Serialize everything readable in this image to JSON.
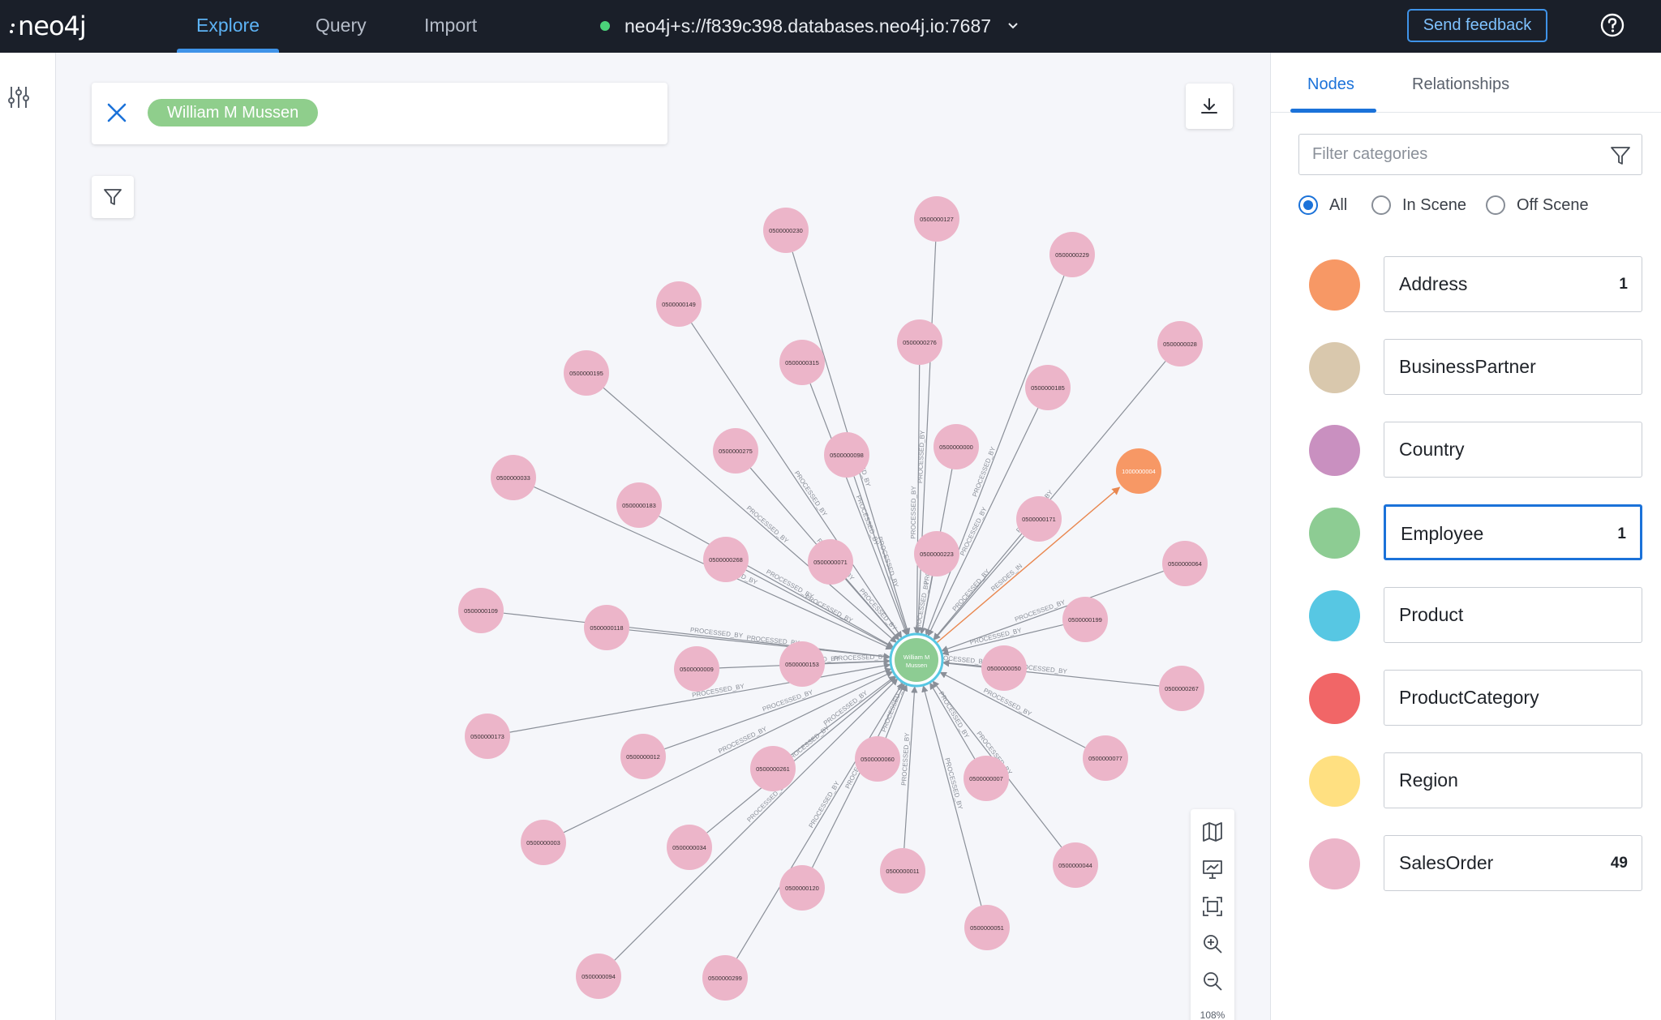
{
  "app": {
    "logo_text": "neo4j"
  },
  "nav": {
    "tabs": [
      {
        "label": "Explore",
        "active": true
      },
      {
        "label": "Query",
        "active": false
      },
      {
        "label": "Import",
        "active": false
      }
    ]
  },
  "connection": {
    "url": "neo4j+s://f839c398.databases.neo4j.io:7687",
    "status_color": "#4bd37a"
  },
  "header": {
    "feedback_label": "Send feedback",
    "help_icon": "help-circle-icon"
  },
  "search": {
    "pill_label": "William M Mussen",
    "pill_color": "#8fce8c"
  },
  "zoom": {
    "level_label": "108%"
  },
  "panel": {
    "tabs": [
      {
        "label": "Nodes",
        "active": true
      },
      {
        "label": "Relationships",
        "active": false
      }
    ],
    "filter_placeholder": "Filter categories",
    "scope_options": [
      {
        "label": "All",
        "selected": true
      },
      {
        "label": "In Scene",
        "selected": false
      },
      {
        "label": "Off Scene",
        "selected": false
      }
    ],
    "categories": [
      {
        "name": "Address",
        "count": "1",
        "color": "#f79865"
      },
      {
        "name": "BusinessPartner",
        "count": "",
        "color": "#d9c8ad"
      },
      {
        "name": "Country",
        "count": "",
        "color": "#c990c0"
      },
      {
        "name": "Employee",
        "count": "1",
        "color": "#8dcc93",
        "focused": true
      },
      {
        "name": "Product",
        "count": "",
        "color": "#57c7e3"
      },
      {
        "name": "ProductCategory",
        "count": "",
        "color": "#f16667"
      },
      {
        "name": "Region",
        "count": "",
        "color": "#ffe081"
      },
      {
        "name": "SalesOrder",
        "count": "49",
        "color": "#ecb5c9"
      }
    ]
  },
  "graph": {
    "center": {
      "label_line1": "William M",
      "label_line2": "Mussen",
      "color": "#8dcc93",
      "ring": "#57c7e3"
    },
    "relationship_label": "PROCESSED_BY",
    "address_label": "1000000004",
    "address_rel_label": "RESIDES_IN",
    "order_color": "#ecb5c9",
    "address_color": "#f79865",
    "orders": [
      "0500000230",
      "0500000127",
      "0500000229",
      "0500000149",
      "0500000276",
      "0500000028",
      "0500000195",
      "0500000315",
      "0500000185",
      "0500000000",
      "0500000033",
      "0500000275",
      "0500000098",
      "0500000183",
      "0500000171",
      "0500000064",
      "0500000268",
      "0500000071",
      "0500000223",
      "0500000109",
      "0500000118",
      "0500000199",
      "0500000009",
      "0500000153",
      "0500000050",
      "0500000267",
      "0500000173",
      "0500000012",
      "0500000261",
      "0500000060",
      "0500000007",
      "0500000077",
      "0500000003",
      "0500000034",
      "0500000044",
      "0500000120",
      "0500000011",
      "0500000051",
      "0500000094",
      "0500000299"
    ]
  }
}
